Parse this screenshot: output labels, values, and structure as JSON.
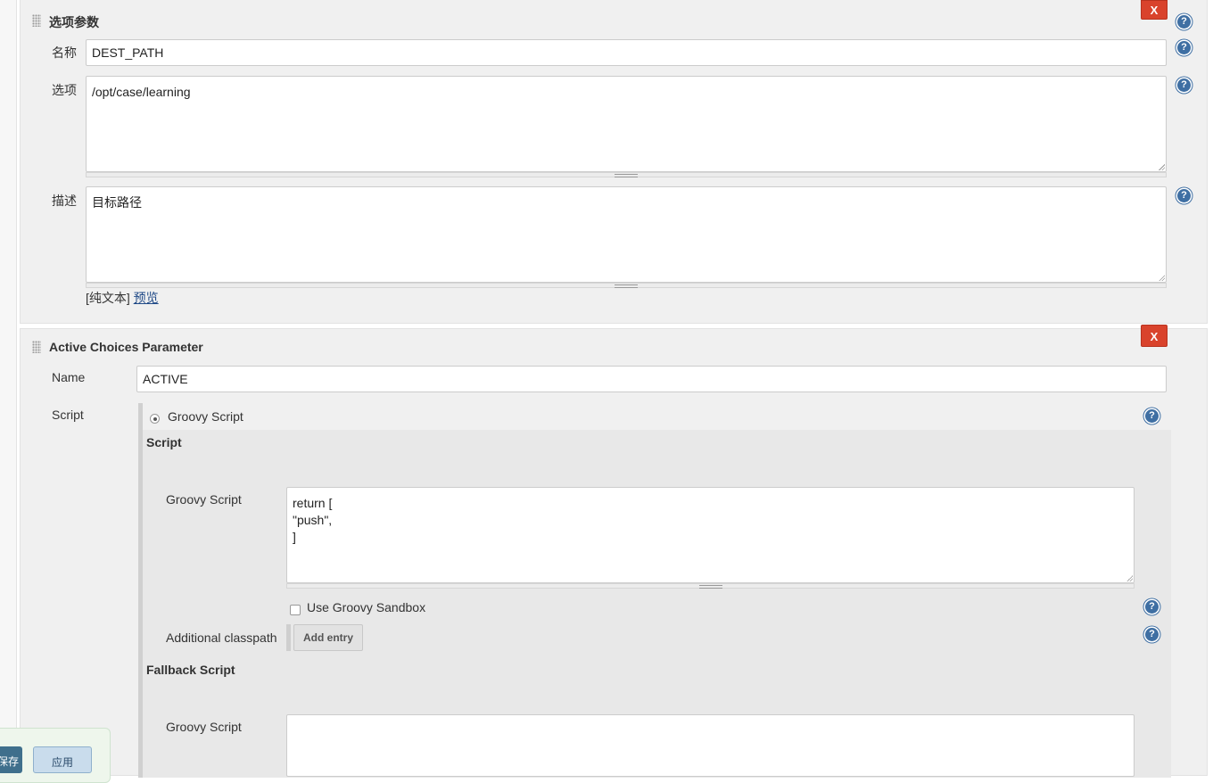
{
  "choice_parameter": {
    "title": "选项参数",
    "delete_label": "X",
    "name_label": "名称",
    "name_value": "DEST_PATH",
    "choices_label": "选项",
    "choices_value": "/opt/case/learning",
    "description_label": "描述",
    "description_value": "目标路径",
    "plain_text_label": "[纯文本]",
    "preview_link": "预览"
  },
  "active_choices_parameter": {
    "title": "Active Choices Parameter",
    "delete_label": "X",
    "name_label": "Name",
    "name_value": "ACTIVE",
    "script_label": "Script",
    "script_type_option": "Groovy Script",
    "script_section": {
      "heading": "Script",
      "groovy_label": "Groovy Script",
      "groovy_value": "return [\n\"push\",\n]",
      "sandbox_label": "Use Groovy Sandbox",
      "sandbox_checked": false,
      "classpath_label": "Additional classpath",
      "add_entry_label": "Add entry"
    },
    "fallback_section": {
      "heading": "Fallback Script",
      "groovy_label": "Groovy Script",
      "groovy_value": ""
    }
  },
  "help_icon_glyph": "?",
  "bottom_bar": {
    "save_label": "保存",
    "apply_label": "应用"
  },
  "colors": {
    "delete_button": "#d9432c",
    "help_icon": "#3f6fa3",
    "link": "#204a87",
    "save_button": "#3f6f8c",
    "apply_button": "#c9dcec"
  }
}
